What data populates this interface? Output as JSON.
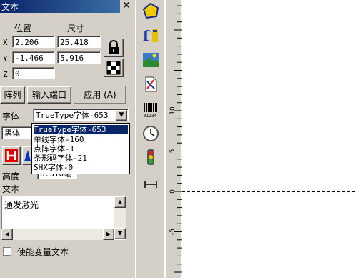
{
  "window": {
    "title": "文本",
    "close_glyph": "×"
  },
  "position": {
    "pos_label": "位置",
    "size_label": "尺寸",
    "x_axis": "X",
    "y_axis": "Y",
    "z_axis": "Z",
    "x_value": "2.206",
    "y_value": "-1.466",
    "z_value": "0",
    "width_value": "25.418",
    "height_value": "5.916"
  },
  "buttons": {
    "array": "阵列",
    "input_port": "输入端口",
    "apply": "应用 (A)"
  },
  "font": {
    "label": "字体",
    "selected": "TrueType字体-653",
    "second_value": "黑体",
    "options": [
      "TrueType字体-653",
      "单线字体-160",
      "点阵字体-1",
      "条形码字体-21",
      "SHX字体-0"
    ]
  },
  "height": {
    "label": "高度",
    "value": "6.310毫"
  },
  "text": {
    "label": "文本",
    "content": "通发激光"
  },
  "variable_text": {
    "label": "使能变量文本",
    "checked": false
  },
  "ruler": {
    "ticks": [
      "10",
      "5",
      "0",
      "-5"
    ]
  },
  "toolbar_icons": [
    "polygon-icon",
    "text-icon",
    "bitmap-icon",
    "vector-file-icon",
    "barcode-icon",
    "delay-icon",
    "io-light-icon",
    "tool-icon"
  ],
  "barcode_digits": "01234"
}
